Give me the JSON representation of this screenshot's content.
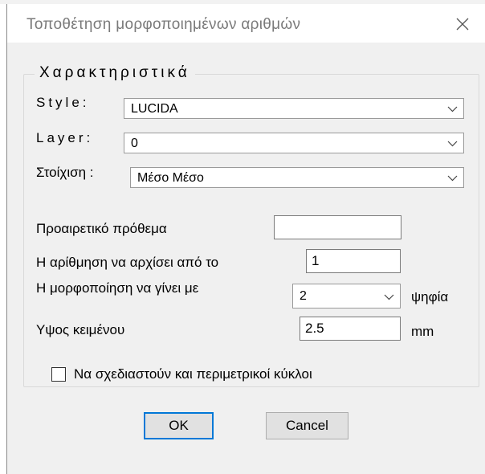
{
  "window": {
    "title": "Τοποθέτηση μορφοποιημένων αριθμών"
  },
  "group": {
    "legend": "Χαρακτηριστικά"
  },
  "fields": {
    "style": {
      "label": "Style:",
      "value": "LUCIDA"
    },
    "layer": {
      "label": "Layer:",
      "value": "0"
    },
    "alignment": {
      "label": "Στοίχιση :",
      "value": "Μέσο Μέσο"
    },
    "prefix": {
      "label": "Προαιρετικό πρόθεμα",
      "value": ""
    },
    "start_number": {
      "label": "Η αρίθμηση να αρχίσει από το",
      "value": "1"
    },
    "digits": {
      "label": "Η μορφοποίηση να γίνει με",
      "value": "2",
      "unit": "ψηφία"
    },
    "text_height": {
      "label": "Υψος κειμένου",
      "value": "2.5",
      "unit": "mm"
    },
    "draw_circles": {
      "label": "Να σχεδιαστούν και περιμετρικοί κύκλοι",
      "checked": false
    }
  },
  "buttons": {
    "ok": "OK",
    "cancel": "Cancel"
  },
  "colors": {
    "dialog_bg": "#f0f0f0",
    "default_button_border": "#0078d7",
    "button_face": "#e1e1e1"
  }
}
